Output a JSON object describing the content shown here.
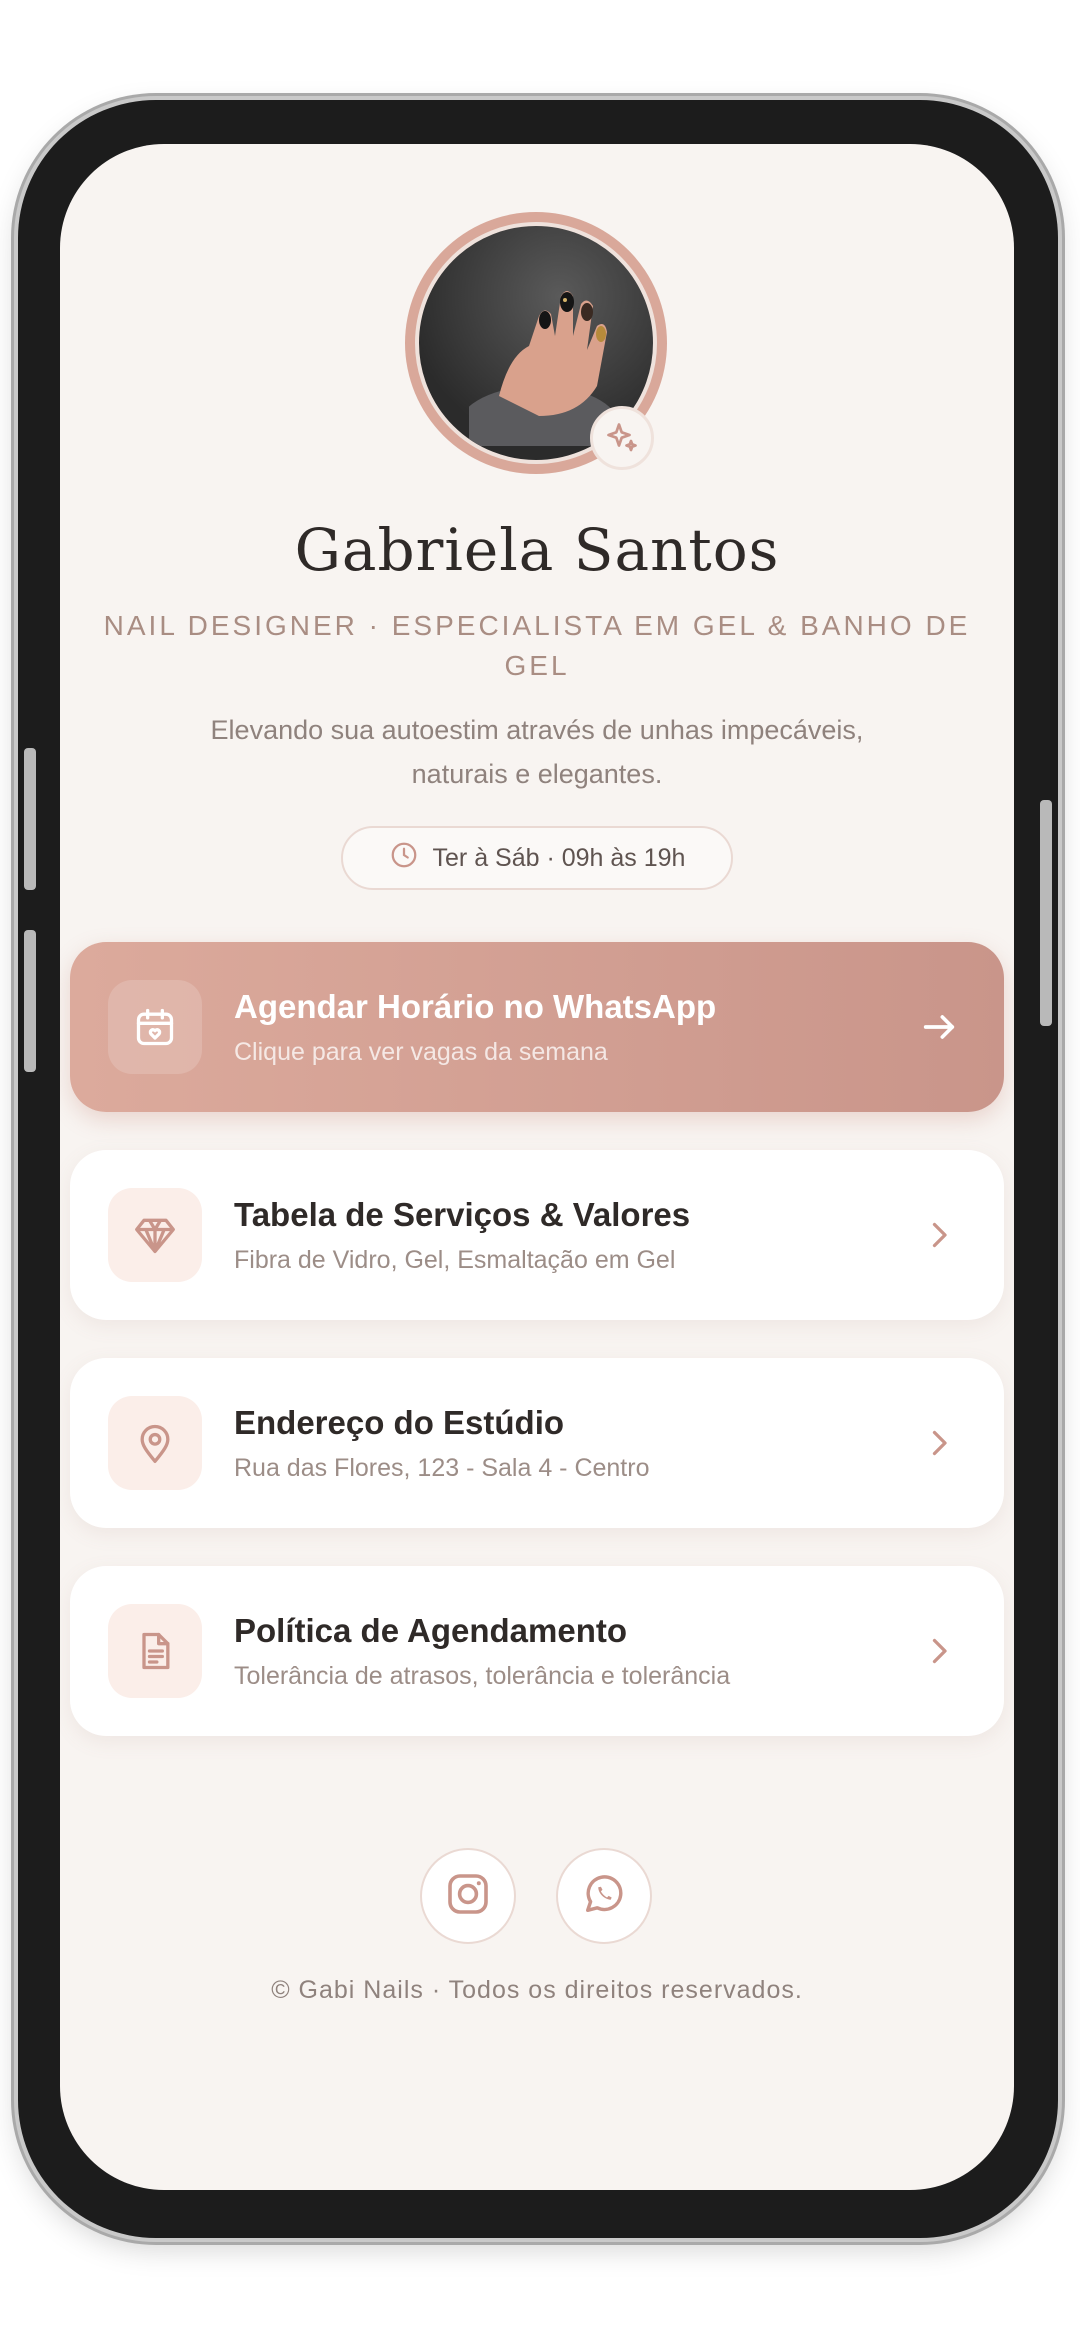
{
  "profile": {
    "name": "Gabriela Santos",
    "role": "NAIL DESIGNER · ESPECIALISTA EM GEL & BANHO DE GEL",
    "bio": "Elevando sua autoestim através de unhas impecáveis, naturais e elegantes.",
    "hours": "Ter à Sáb · 09h às 19h",
    "avatar_icon": "nail-photo",
    "badge_icon": "sparkle-icon"
  },
  "links": [
    {
      "title": "Agendar Horário no WhatsApp",
      "subtitle": "Clique para ver vagas da semana",
      "icon": "calendar-heart-icon",
      "arrow": "arrow-right-icon"
    },
    {
      "title": "Tabela de Serviços & Valores",
      "subtitle": "Fibra de Vidro, Gel, Esmaltação em Gel",
      "icon": "diamond-icon",
      "arrow": "chevron-right-icon"
    },
    {
      "title": "Endereço do Estúdio",
      "subtitle": "Rua das Flores, 123 - Sala 4 - Centro",
      "icon": "map-pin-icon",
      "arrow": "chevron-right-icon"
    },
    {
      "title": "Política de Agendamento",
      "subtitle": "Tolerância de atrasos, tolerância e tolerância",
      "icon": "document-icon",
      "arrow": "chevron-right-icon"
    }
  ],
  "social": [
    {
      "icon": "instagram-icon"
    },
    {
      "icon": "whatsapp-icon"
    }
  ],
  "footer": {
    "text": "© Gabi Nails · Todos os direitos reservados."
  },
  "colors": {
    "background": "#f8f4f1",
    "accent": "#d4a192",
    "icon_tile": "#fbeee9",
    "text_dark": "#2f2a28",
    "text_muted": "#9c8d87"
  }
}
